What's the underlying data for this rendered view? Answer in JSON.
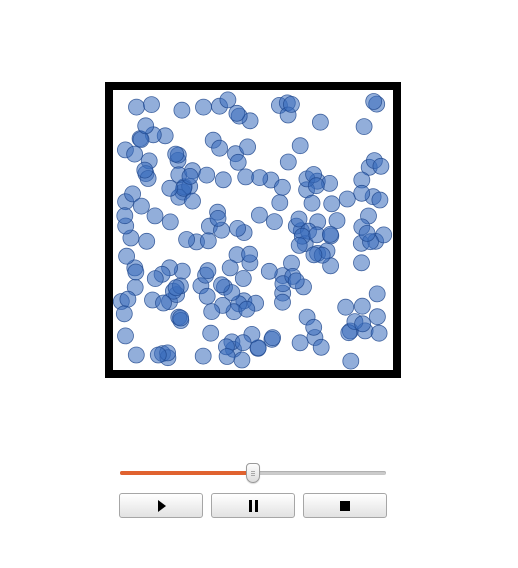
{
  "simulation": {
    "particle_color": "#2f65b0",
    "particle_fill": "rgba(56,108,188,0.55)",
    "particle_stroke": "rgba(30,70,140,0.8)",
    "border_color": "#000000"
  },
  "speed_slider": {
    "value_fraction": 0.5,
    "fill_color": "#e0622f",
    "track_color": "#cfcfcf"
  },
  "controls": {
    "play_icon": "play-icon",
    "pause_icon": "pause-icon",
    "stop_icon": "stop-icon"
  }
}
